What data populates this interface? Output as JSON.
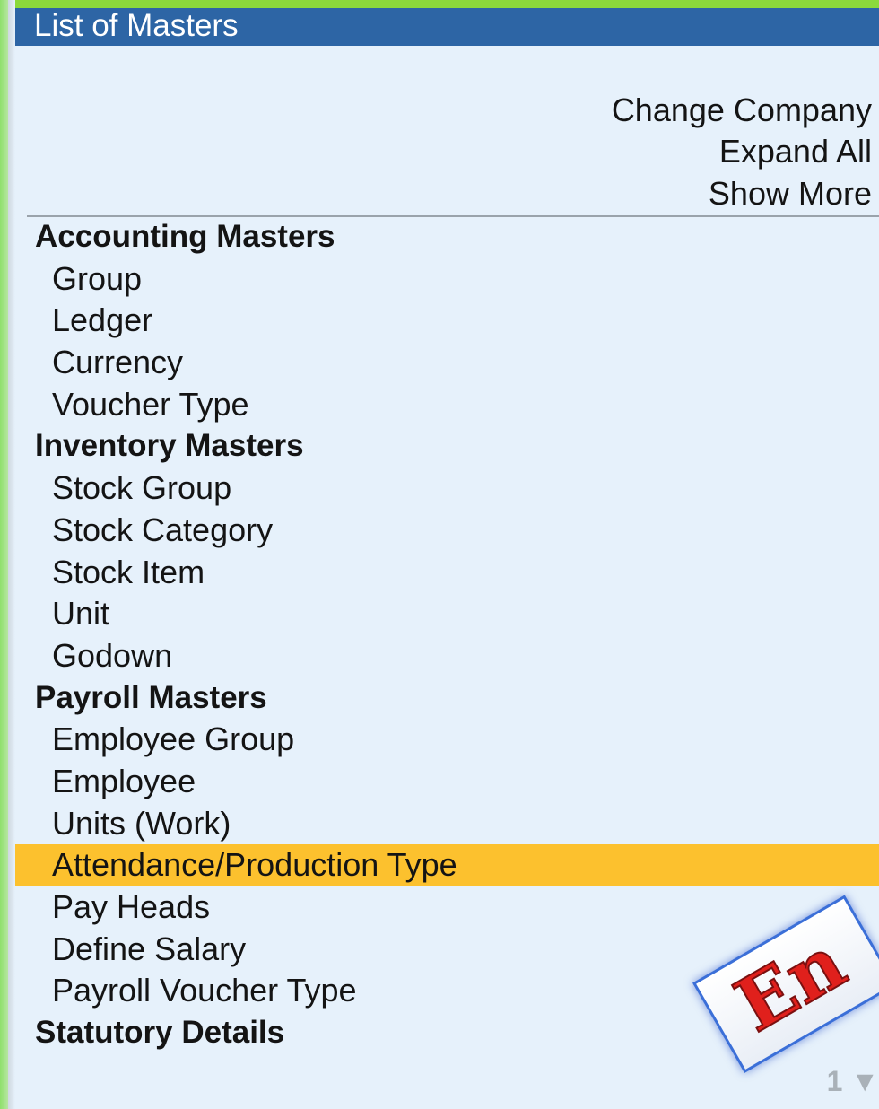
{
  "window": {
    "title": "List of Masters"
  },
  "actions": [
    {
      "label": "Change Company"
    },
    {
      "label": "Expand All"
    },
    {
      "label": "Show More"
    }
  ],
  "sections": [
    {
      "heading": "Accounting Masters",
      "items": [
        "Group",
        "Ledger",
        "Currency",
        "Voucher Type"
      ]
    },
    {
      "heading": "Inventory Masters",
      "items": [
        "Stock Group",
        "Stock Category",
        "Stock Item",
        "Unit",
        "Godown"
      ]
    },
    {
      "heading": "Payroll Masters",
      "items": [
        "Employee Group",
        "Employee",
        "Units (Work)",
        "Attendance/Production Type",
        "Pay Heads",
        "Define Salary",
        "Payroll Voucher Type"
      ]
    },
    {
      "heading": "Statutory Details",
      "items": []
    }
  ],
  "selected_item": "Attendance/Production Type",
  "emblem": {
    "text": "En"
  },
  "pagination": {
    "text": "1 ▼"
  },
  "colors": {
    "title_bar": "#2d65a5",
    "background": "#e6f1fb",
    "selection": "#fcc12e",
    "accent_green": "#8bd93b"
  }
}
